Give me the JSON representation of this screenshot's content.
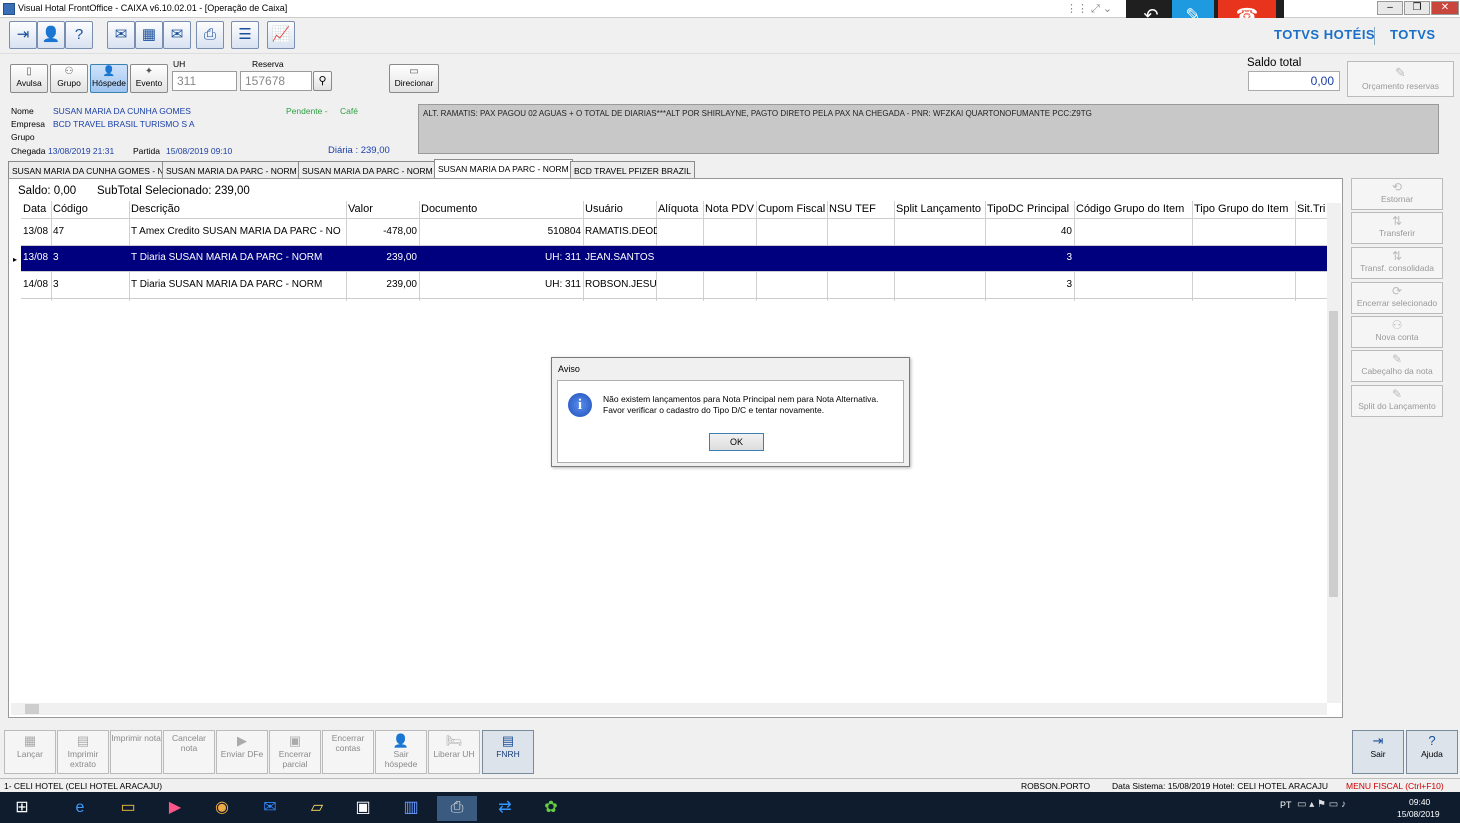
{
  "window": {
    "title": "Visual Hotal FrontOffice - CAIXA v6.10.02.01 - [Operação de Caixa]"
  },
  "brand": {
    "left": "TOTVS HOTÉIS",
    "right": "TOTVS"
  },
  "guest_type": {
    "avulsa": "Avulsa",
    "grupo": "Grupo",
    "hospede": "Hóspede",
    "evento": "Evento"
  },
  "search": {
    "uh_label": "UH",
    "uh_value": "311",
    "reserva_label": "Reserva",
    "reserva_value": "157678",
    "direcionar": "Direcionar"
  },
  "saldo_total": {
    "label": "Saldo total",
    "value": "0,00",
    "orcamento": "Orçamento reservas"
  },
  "guest": {
    "nome_label": "Nome",
    "nome": "SUSAN MARIA DA CUNHA GOMES",
    "empresa_label": "Empresa",
    "empresa": "BCD TRAVEL BRASIL TURISMO S A",
    "grupo_label": "Grupo",
    "chegada_label": "Chegada",
    "chegada": "13/08/2019 21:31",
    "partida_label": "Partida",
    "partida": "15/08/2019 09:10",
    "pendente": "Pendente -",
    "cafe": "Café",
    "diaria": "Diária : 239,00"
  },
  "notes": "ALT. RAMATIS: PAX PAGOU 02 AGUAS + O TOTAL DE DIARIAS***ALT POR SHIRLAYNE, PAGTO DIRETO PELA PAX NA CHEGADA - PNR: WFZKAI QUARTONOFUMANTE PCC:Z9TG",
  "tabs": [
    "SUSAN MARIA DA CUNHA GOMES - N",
    "SUSAN MARIA DA  PARC - NORM",
    "SUSAN MARIA DA  PARC - NORM",
    "SUSAN MARIA DA  PARC - NORM",
    "BCD TRAVEL PFIZER BRAZIL"
  ],
  "summary": {
    "saldo": "Saldo:  0,00",
    "subtotal": "SubTotal Selecionado: 239,00"
  },
  "columns": [
    "Data",
    "Código",
    "Descrição",
    "Valor",
    "Documento",
    "Usuário",
    "Alíquota",
    "Nota PDV",
    "Cupom Fiscal",
    "NSU TEF",
    "Split Lançamento",
    "TipoDC Principal",
    "Código Grupo do Item",
    "Tipo Grupo do Item",
    "Sit.Tri"
  ],
  "rows": [
    {
      "data": "13/08",
      "codigo": "47",
      "descricao": "T Amex Credito SUSAN MARIA DA  PARC - NO",
      "valor": "-478,00",
      "documento": "510804",
      "usuario": "RAMATIS.DEODA",
      "tipodc": "40"
    },
    {
      "data": "13/08",
      "codigo": "3",
      "descricao": "T Diaria SUSAN MARIA DA  PARC - NORM",
      "valor": "239,00",
      "documento": "UH: 311",
      "usuario": "JEAN.SANTOS",
      "tipodc": "3"
    },
    {
      "data": "14/08",
      "codigo": "3",
      "descricao": "T Diaria SUSAN MARIA DA  PARC - NORM",
      "valor": "239,00",
      "documento": "UH: 311",
      "usuario": "ROBSON.JESUS",
      "tipodc": "3"
    }
  ],
  "side_actions": {
    "estornar": "Estornar",
    "transferir": "Transferir",
    "transf_consolidada": "Transf. consolidada",
    "encerrar_selecionado": "Encerrar selecionado",
    "nova_conta": "Nova conta",
    "cabecalho": "Cabeçalho da nota",
    "split": "Split do Lançamento"
  },
  "bottom_actions": {
    "lancar": "Lançar",
    "imprimir_extrato": "Imprimir extrato",
    "imprimir_nota": "Imprimir nota",
    "cancelar_nota": "Cancelar nota",
    "enviar_dfe": "Enviar DFe",
    "encerrar_parcial": "Encerrar parcial",
    "encerrar_contas": "Encerrar contas",
    "sair_hospede": "Sair hóspede",
    "liberar_uh": "Liberar UH",
    "fnrh": "FNRH",
    "sair": "Sair",
    "ajuda": "Ajuda"
  },
  "status": {
    "hotel": "1- CELI HOTEL (CELI  HOTEL ARACAJU)",
    "user": "ROBSON.PORTO",
    "data_sistema": "Data Sistema: 15/08/2019  Hotel: CELI  HOTEL ARACAJU",
    "menu_fiscal": "MENU FISCAL (Ctrl+F10)"
  },
  "taskbar": {
    "lang": "PT",
    "time": "09:40",
    "date": "15/08/2019"
  },
  "dialog": {
    "title": "Aviso",
    "line1": "Não existem lançamentos para Nota Principal nem para Nota Alternativa.",
    "line2": "Favor verificar o cadastro do Tipo D/C e tentar novamente.",
    "ok": "OK"
  },
  "colors": {
    "selected_row": "#00007e",
    "brand_blue": "#1a6fc9",
    "call_red": "#e8341c",
    "call_blue": "#1e9be0"
  }
}
